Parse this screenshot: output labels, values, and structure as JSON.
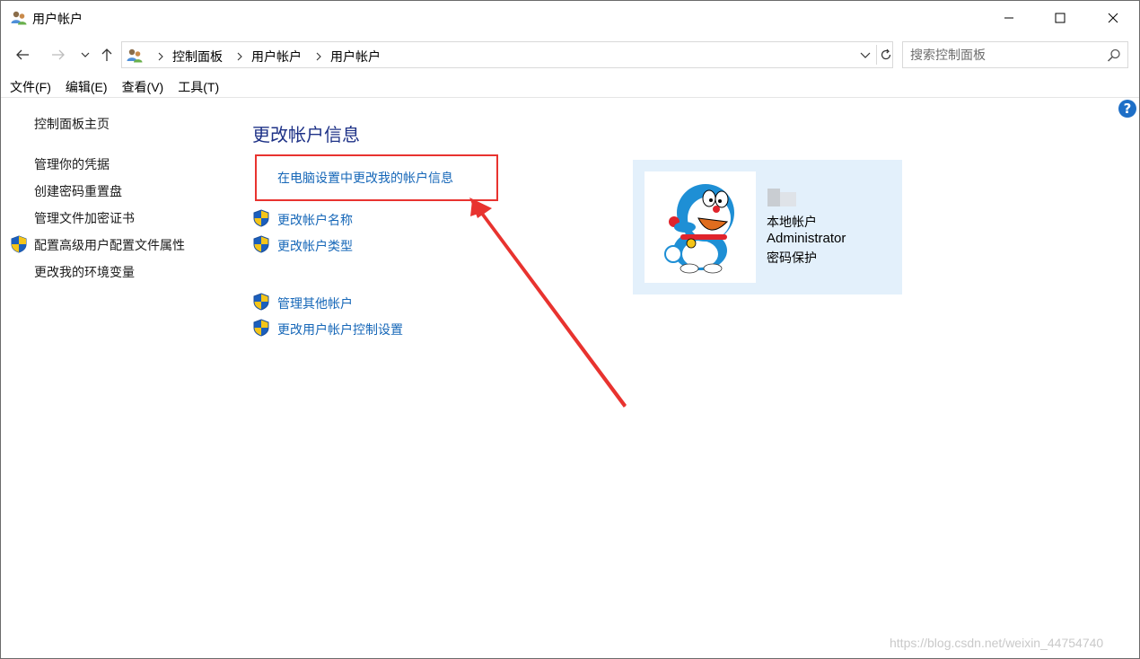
{
  "window": {
    "title": "用户帐户",
    "minimize_icon": "minimize-icon",
    "maximize_icon": "maximize-icon",
    "close_icon": "close-icon"
  },
  "navigation": {
    "back_icon": "arrow-left-icon",
    "forward_icon": "arrow-right-icon",
    "recent_icon": "chevron-down-icon",
    "up_icon": "arrow-up-icon",
    "breadcrumbs": [
      "控制面板",
      "用户帐户",
      "用户帐户"
    ],
    "refresh_icon": "refresh-icon"
  },
  "search": {
    "placeholder": "搜索控制面板",
    "value": ""
  },
  "menu": {
    "file": "文件(F)",
    "edit": "编辑(E)",
    "view": "查看(V)",
    "tools": "工具(T)"
  },
  "sidebar": {
    "home": "控制面板主页",
    "items": [
      {
        "label": "管理你的凭据",
        "shield": false
      },
      {
        "label": "创建密码重置盘",
        "shield": false
      },
      {
        "label": "管理文件加密证书",
        "shield": false
      },
      {
        "label": "配置高级用户配置文件属性",
        "shield": true
      },
      {
        "label": "更改我的环境变量",
        "shield": false
      }
    ]
  },
  "main": {
    "title": "更改帐户信息",
    "pc_settings_link": "在电脑设置中更改我的帐户信息",
    "tasks": [
      {
        "label": "更改帐户名称",
        "shield": true
      },
      {
        "label": "更改帐户类型",
        "shield": true
      }
    ],
    "more_tasks": [
      {
        "label": "管理其他帐户",
        "shield": true
      },
      {
        "label": "更改用户帐户控制设置",
        "shield": true
      }
    ]
  },
  "account": {
    "type": "本地帐户",
    "name": "Administrator",
    "password_status": "密码保护"
  },
  "annotation": {
    "highlight_color": "#e8332f"
  },
  "watermark": "https://blog.csdn.net/weixin_44754740",
  "colors": {
    "link": "#1667b8",
    "title": "#1e3287",
    "tile_bg": "#e3f0fb"
  }
}
